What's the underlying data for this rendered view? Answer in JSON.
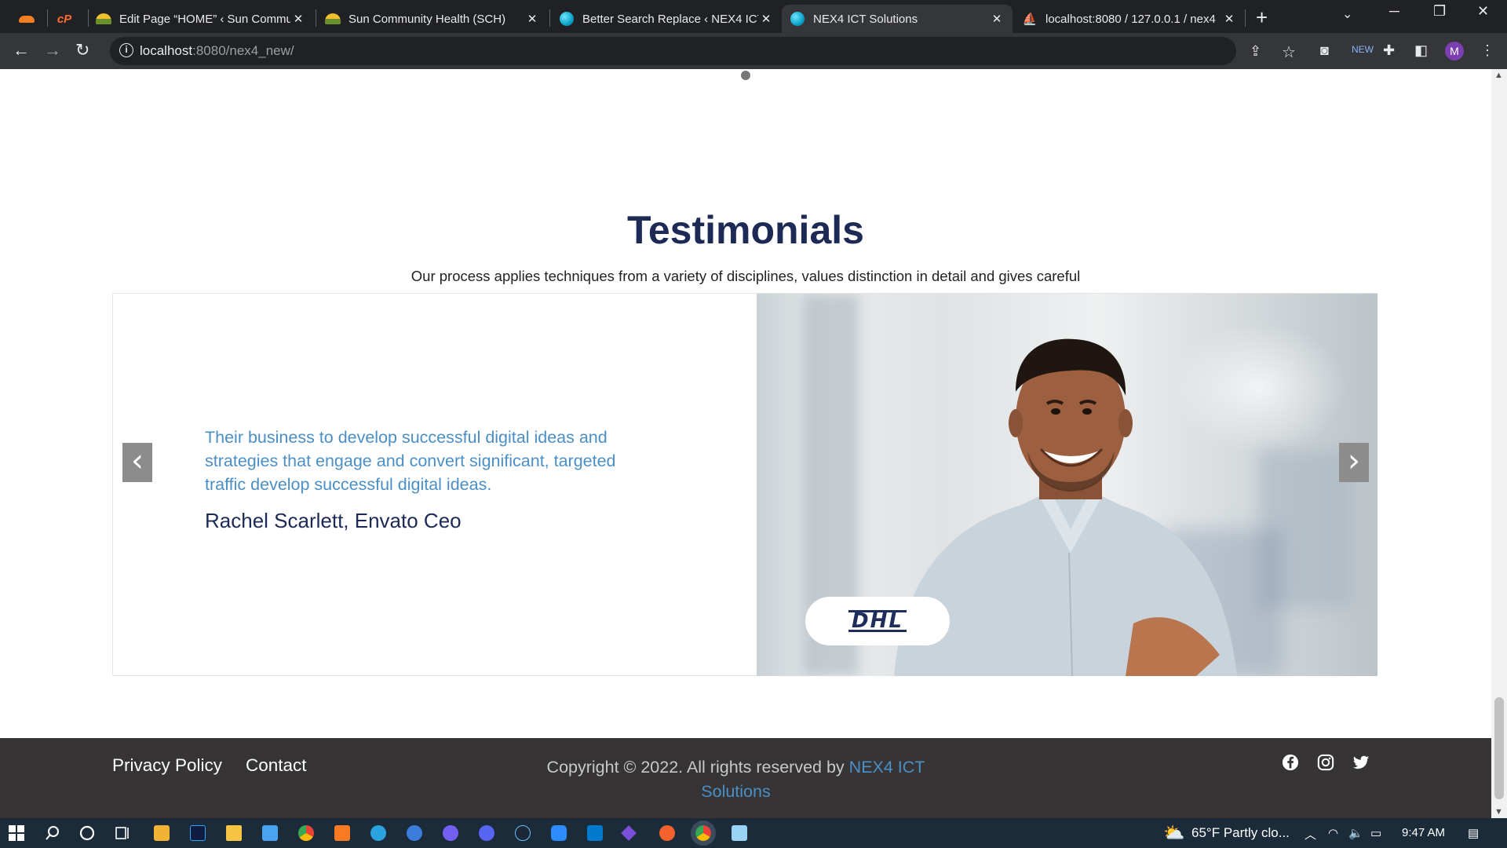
{
  "browser": {
    "tabs": [
      {
        "title": "",
        "favicon": "cloudflare-icon"
      },
      {
        "title": "",
        "favicon": "cpanel-icon"
      },
      {
        "title": "Edit Page “HOME” ‹ Sun Commu",
        "favicon": "sun-community-icon"
      },
      {
        "title": "Sun Community Health (SCH)",
        "favicon": "sun-community-icon"
      },
      {
        "title": "Better Search Replace ‹ NEX4 ICT",
        "favicon": "globe-icon"
      },
      {
        "title": "NEX4 ICT Solutions",
        "favicon": "globe-icon",
        "active": true
      },
      {
        "title": "localhost:8080 / 127.0.0.1 / nex4",
        "favicon": "phpmyadmin-icon"
      }
    ],
    "url_host": "localhost",
    "url_rest": ":8080/nex4_new/",
    "profile_initial": "M"
  },
  "page": {
    "testimonials": {
      "title": "Testimonials",
      "subtitle": "Our process applies techniques from a variety of disciplines, values distinction in detail and gives careful",
      "quote": "Their business to develop successful digital ideas and strategies that engage and convert significant, targeted traffic develop successful digital ideas.",
      "author": "Rachel Scarlett, Envato Ceo",
      "company_logo": "DHL",
      "prev_arrow": "‹",
      "next_arrow": "›"
    },
    "footer": {
      "links": [
        "Privacy Policy",
        "Contact"
      ],
      "copyright_prefix": "Copyright © 2022. All rights reserved by ",
      "brand": "NEX4 ICT Solutions",
      "social": [
        "facebook-icon",
        "instagram-icon",
        "twitter-icon"
      ]
    }
  },
  "taskbar": {
    "weather": "65°F  Partly clo...",
    "time": "9:47 AM"
  },
  "colors": {
    "heading": "#1c2a55",
    "accent": "#4a8fc6",
    "footer_bg": "#363435"
  }
}
